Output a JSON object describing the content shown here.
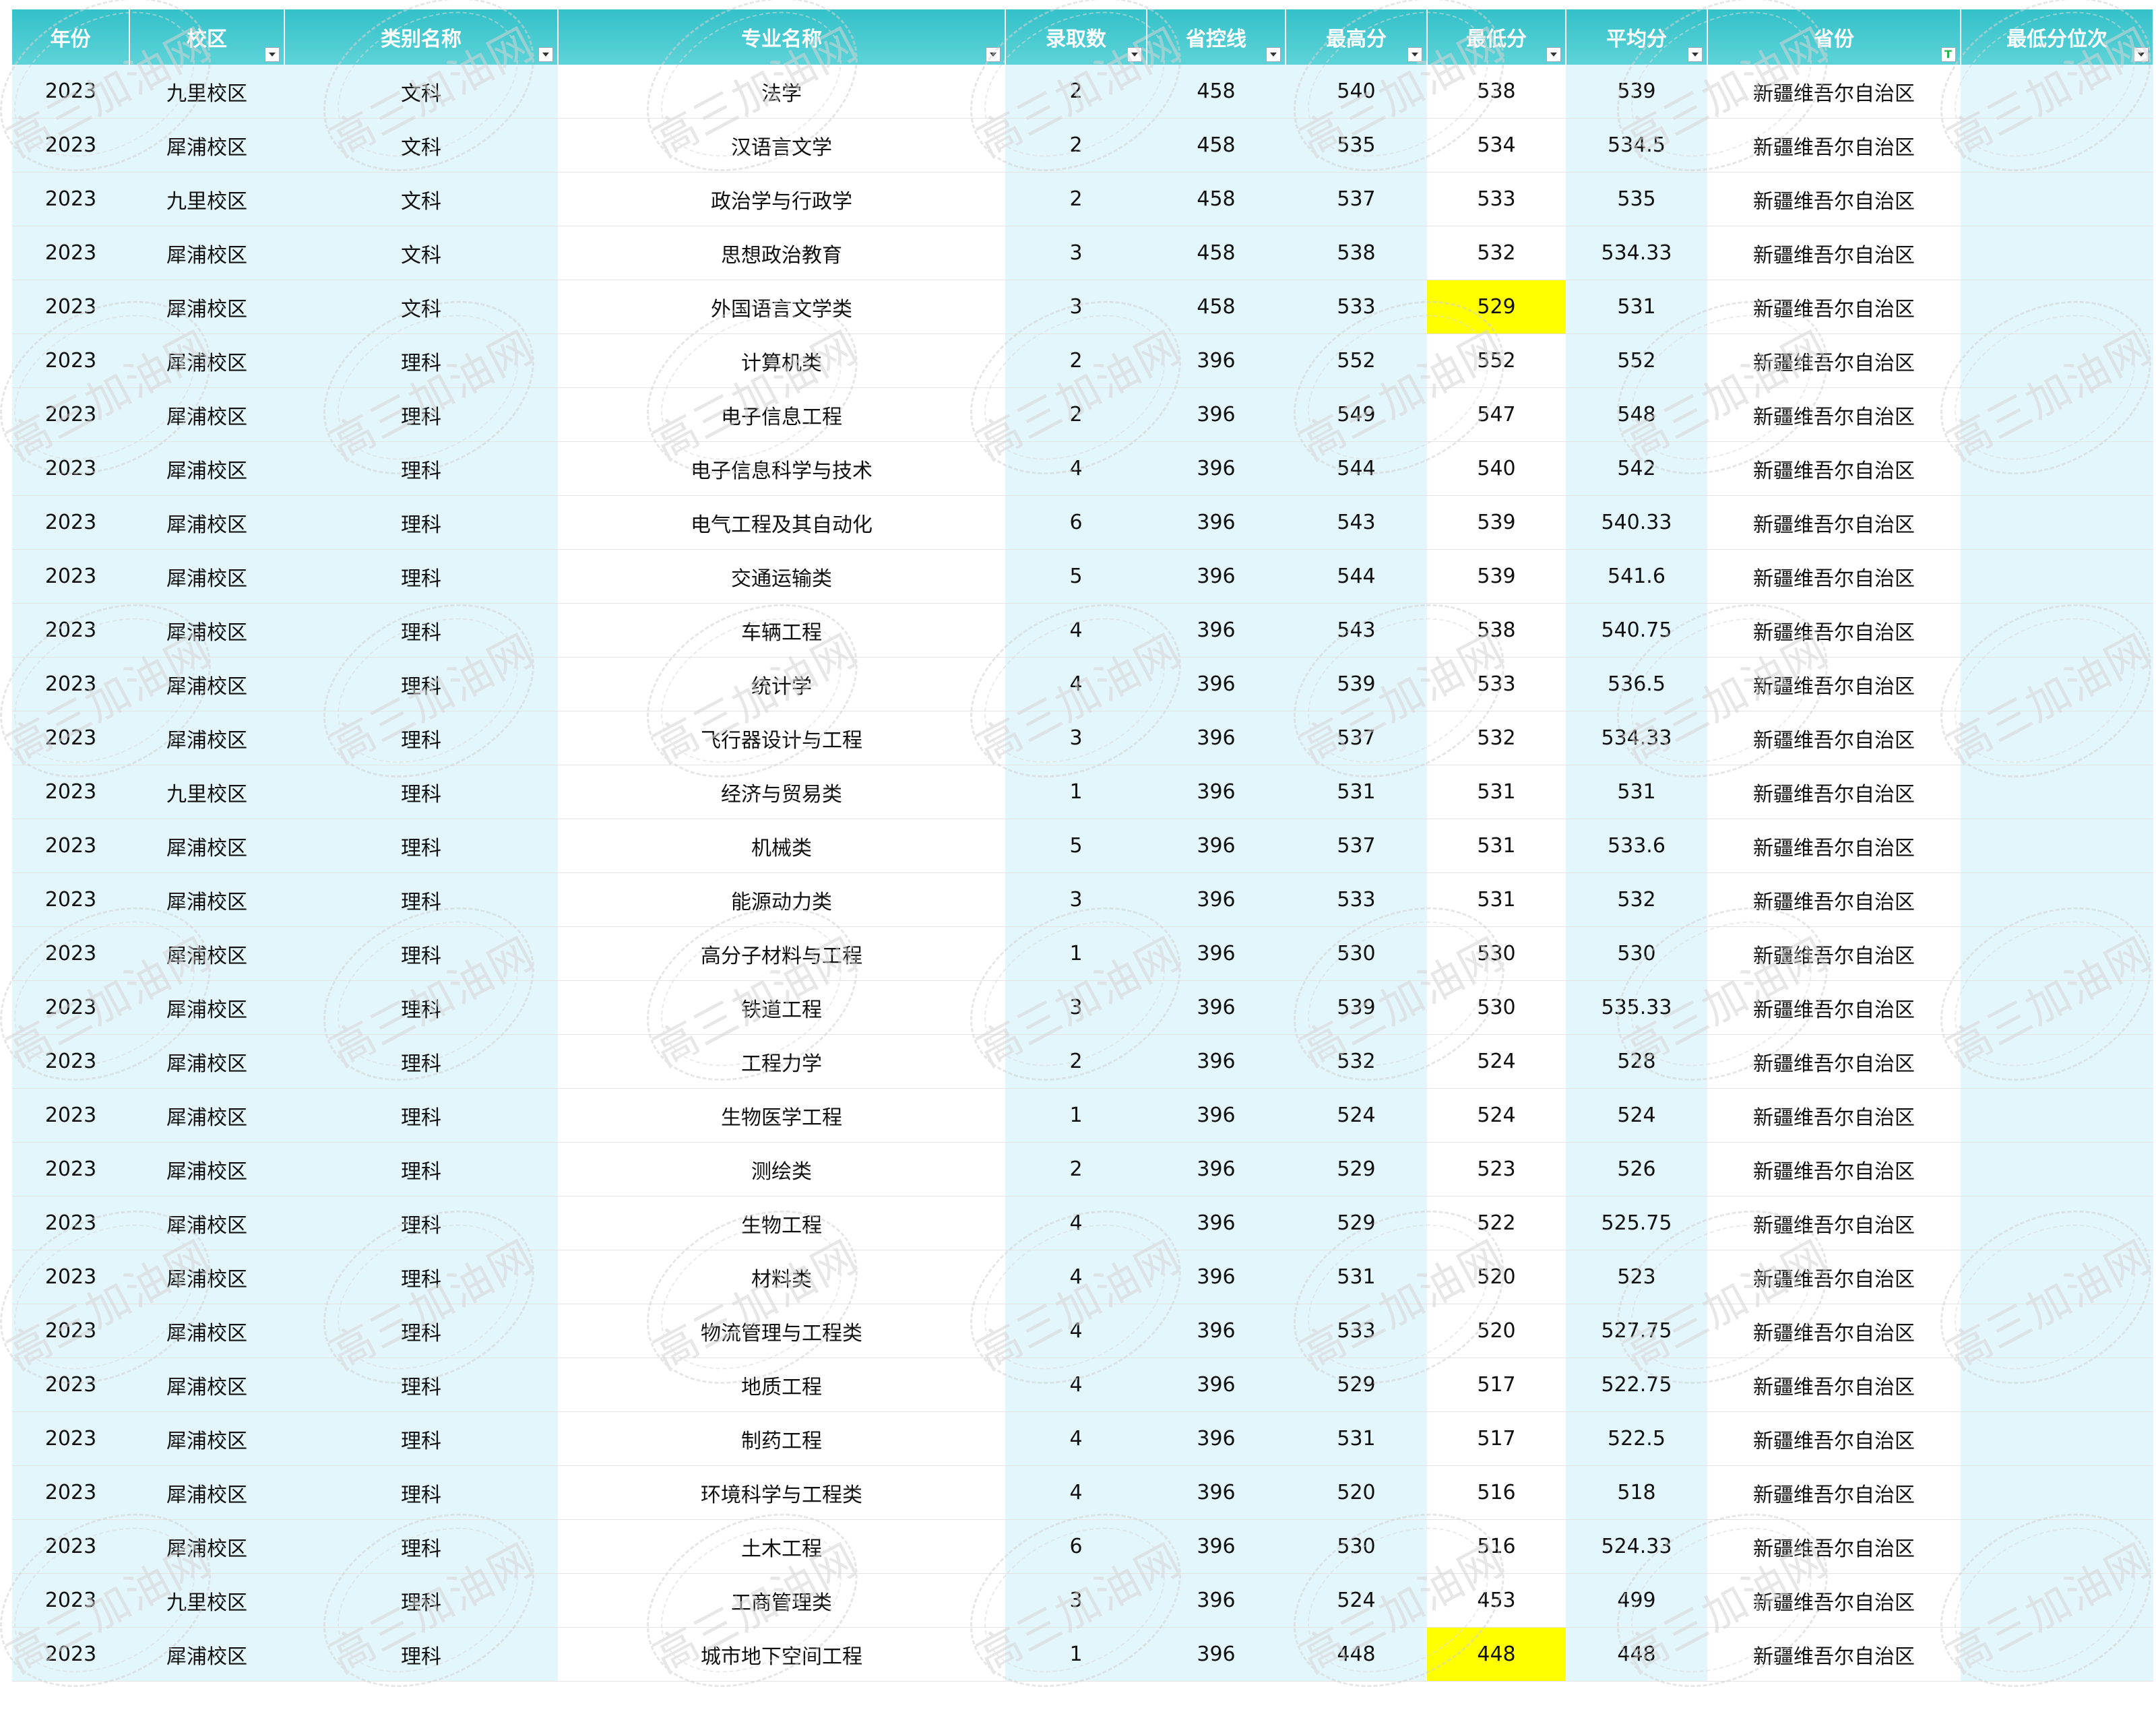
{
  "columns": [
    {
      "key": "year",
      "label": "年份"
    },
    {
      "key": "campus",
      "label": "校区"
    },
    {
      "key": "category",
      "label": "类别名称"
    },
    {
      "key": "major",
      "label": "专业名称"
    },
    {
      "key": "admitted",
      "label": "录取数"
    },
    {
      "key": "control_line",
      "label": "省控线"
    },
    {
      "key": "max",
      "label": "最高分"
    },
    {
      "key": "min",
      "label": "最低分"
    },
    {
      "key": "avg",
      "label": "平均分"
    },
    {
      "key": "province",
      "label": "省份"
    },
    {
      "key": "min_rank",
      "label": "最低分位次"
    }
  ],
  "highlight_color": "#ffff00",
  "header_color": "#33c1c8",
  "rows": [
    {
      "year": "2023",
      "campus": "九里校区",
      "category": "文科",
      "major": "法学",
      "admitted": "2",
      "control_line": "458",
      "max": "540",
      "min": "538",
      "avg": "539",
      "province": "新疆维吾尔自治区",
      "min_rank": "",
      "min_highlight": false
    },
    {
      "year": "2023",
      "campus": "犀浦校区",
      "category": "文科",
      "major": "汉语言文学",
      "admitted": "2",
      "control_line": "458",
      "max": "535",
      "min": "534",
      "avg": "534.5",
      "province": "新疆维吾尔自治区",
      "min_rank": "",
      "min_highlight": false
    },
    {
      "year": "2023",
      "campus": "九里校区",
      "category": "文科",
      "major": "政治学与行政学",
      "admitted": "2",
      "control_line": "458",
      "max": "537",
      "min": "533",
      "avg": "535",
      "province": "新疆维吾尔自治区",
      "min_rank": "",
      "min_highlight": false
    },
    {
      "year": "2023",
      "campus": "犀浦校区",
      "category": "文科",
      "major": "思想政治教育",
      "admitted": "3",
      "control_line": "458",
      "max": "538",
      "min": "532",
      "avg": "534.33",
      "province": "新疆维吾尔自治区",
      "min_rank": "",
      "min_highlight": false
    },
    {
      "year": "2023",
      "campus": "犀浦校区",
      "category": "文科",
      "major": "外国语言文学类",
      "admitted": "3",
      "control_line": "458",
      "max": "533",
      "min": "529",
      "avg": "531",
      "province": "新疆维吾尔自治区",
      "min_rank": "",
      "min_highlight": true
    },
    {
      "year": "2023",
      "campus": "犀浦校区",
      "category": "理科",
      "major": "计算机类",
      "admitted": "2",
      "control_line": "396",
      "max": "552",
      "min": "552",
      "avg": "552",
      "province": "新疆维吾尔自治区",
      "min_rank": "",
      "min_highlight": false
    },
    {
      "year": "2023",
      "campus": "犀浦校区",
      "category": "理科",
      "major": "电子信息工程",
      "admitted": "2",
      "control_line": "396",
      "max": "549",
      "min": "547",
      "avg": "548",
      "province": "新疆维吾尔自治区",
      "min_rank": "",
      "min_highlight": false
    },
    {
      "year": "2023",
      "campus": "犀浦校区",
      "category": "理科",
      "major": "电子信息科学与技术",
      "admitted": "4",
      "control_line": "396",
      "max": "544",
      "min": "540",
      "avg": "542",
      "province": "新疆维吾尔自治区",
      "min_rank": "",
      "min_highlight": false
    },
    {
      "year": "2023",
      "campus": "犀浦校区",
      "category": "理科",
      "major": "电气工程及其自动化",
      "admitted": "6",
      "control_line": "396",
      "max": "543",
      "min": "539",
      "avg": "540.33",
      "province": "新疆维吾尔自治区",
      "min_rank": "",
      "min_highlight": false
    },
    {
      "year": "2023",
      "campus": "犀浦校区",
      "category": "理科",
      "major": "交通运输类",
      "admitted": "5",
      "control_line": "396",
      "max": "544",
      "min": "539",
      "avg": "541.6",
      "province": "新疆维吾尔自治区",
      "min_rank": "",
      "min_highlight": false
    },
    {
      "year": "2023",
      "campus": "犀浦校区",
      "category": "理科",
      "major": "车辆工程",
      "admitted": "4",
      "control_line": "396",
      "max": "543",
      "min": "538",
      "avg": "540.75",
      "province": "新疆维吾尔自治区",
      "min_rank": "",
      "min_highlight": false
    },
    {
      "year": "2023",
      "campus": "犀浦校区",
      "category": "理科",
      "major": "统计学",
      "admitted": "4",
      "control_line": "396",
      "max": "539",
      "min": "533",
      "avg": "536.5",
      "province": "新疆维吾尔自治区",
      "min_rank": "",
      "min_highlight": false
    },
    {
      "year": "2023",
      "campus": "犀浦校区",
      "category": "理科",
      "major": "飞行器设计与工程",
      "admitted": "3",
      "control_line": "396",
      "max": "537",
      "min": "532",
      "avg": "534.33",
      "province": "新疆维吾尔自治区",
      "min_rank": "",
      "min_highlight": false
    },
    {
      "year": "2023",
      "campus": "九里校区",
      "category": "理科",
      "major": "经济与贸易类",
      "admitted": "1",
      "control_line": "396",
      "max": "531",
      "min": "531",
      "avg": "531",
      "province": "新疆维吾尔自治区",
      "min_rank": "",
      "min_highlight": false
    },
    {
      "year": "2023",
      "campus": "犀浦校区",
      "category": "理科",
      "major": "机械类",
      "admitted": "5",
      "control_line": "396",
      "max": "537",
      "min": "531",
      "avg": "533.6",
      "province": "新疆维吾尔自治区",
      "min_rank": "",
      "min_highlight": false
    },
    {
      "year": "2023",
      "campus": "犀浦校区",
      "category": "理科",
      "major": "能源动力类",
      "admitted": "3",
      "control_line": "396",
      "max": "533",
      "min": "531",
      "avg": "532",
      "province": "新疆维吾尔自治区",
      "min_rank": "",
      "min_highlight": false
    },
    {
      "year": "2023",
      "campus": "犀浦校区",
      "category": "理科",
      "major": "高分子材料与工程",
      "admitted": "1",
      "control_line": "396",
      "max": "530",
      "min": "530",
      "avg": "530",
      "province": "新疆维吾尔自治区",
      "min_rank": "",
      "min_highlight": false
    },
    {
      "year": "2023",
      "campus": "犀浦校区",
      "category": "理科",
      "major": "铁道工程",
      "admitted": "3",
      "control_line": "396",
      "max": "539",
      "min": "530",
      "avg": "535.33",
      "province": "新疆维吾尔自治区",
      "min_rank": "",
      "min_highlight": false
    },
    {
      "year": "2023",
      "campus": "犀浦校区",
      "category": "理科",
      "major": "工程力学",
      "admitted": "2",
      "control_line": "396",
      "max": "532",
      "min": "524",
      "avg": "528",
      "province": "新疆维吾尔自治区",
      "min_rank": "",
      "min_highlight": false
    },
    {
      "year": "2023",
      "campus": "犀浦校区",
      "category": "理科",
      "major": "生物医学工程",
      "admitted": "1",
      "control_line": "396",
      "max": "524",
      "min": "524",
      "avg": "524",
      "province": "新疆维吾尔自治区",
      "min_rank": "",
      "min_highlight": false
    },
    {
      "year": "2023",
      "campus": "犀浦校区",
      "category": "理科",
      "major": "测绘类",
      "admitted": "2",
      "control_line": "396",
      "max": "529",
      "min": "523",
      "avg": "526",
      "province": "新疆维吾尔自治区",
      "min_rank": "",
      "min_highlight": false
    },
    {
      "year": "2023",
      "campus": "犀浦校区",
      "category": "理科",
      "major": "生物工程",
      "admitted": "4",
      "control_line": "396",
      "max": "529",
      "min": "522",
      "avg": "525.75",
      "province": "新疆维吾尔自治区",
      "min_rank": "",
      "min_highlight": false
    },
    {
      "year": "2023",
      "campus": "犀浦校区",
      "category": "理科",
      "major": "材料类",
      "admitted": "4",
      "control_line": "396",
      "max": "531",
      "min": "520",
      "avg": "523",
      "province": "新疆维吾尔自治区",
      "min_rank": "",
      "min_highlight": false
    },
    {
      "year": "2023",
      "campus": "犀浦校区",
      "category": "理科",
      "major": "物流管理与工程类",
      "admitted": "4",
      "control_line": "396",
      "max": "533",
      "min": "520",
      "avg": "527.75",
      "province": "新疆维吾尔自治区",
      "min_rank": "",
      "min_highlight": false
    },
    {
      "year": "2023",
      "campus": "犀浦校区",
      "category": "理科",
      "major": "地质工程",
      "admitted": "4",
      "control_line": "396",
      "max": "529",
      "min": "517",
      "avg": "522.75",
      "province": "新疆维吾尔自治区",
      "min_rank": "",
      "min_highlight": false
    },
    {
      "year": "2023",
      "campus": "犀浦校区",
      "category": "理科",
      "major": "制药工程",
      "admitted": "4",
      "control_line": "396",
      "max": "531",
      "min": "517",
      "avg": "522.5",
      "province": "新疆维吾尔自治区",
      "min_rank": "",
      "min_highlight": false
    },
    {
      "year": "2023",
      "campus": "犀浦校区",
      "category": "理科",
      "major": "环境科学与工程类",
      "admitted": "4",
      "control_line": "396",
      "max": "520",
      "min": "516",
      "avg": "518",
      "province": "新疆维吾尔自治区",
      "min_rank": "",
      "min_highlight": false
    },
    {
      "year": "2023",
      "campus": "犀浦校区",
      "category": "理科",
      "major": "土木工程",
      "admitted": "6",
      "control_line": "396",
      "max": "530",
      "min": "516",
      "avg": "524.33",
      "province": "新疆维吾尔自治区",
      "min_rank": "",
      "min_highlight": false
    },
    {
      "year": "2023",
      "campus": "九里校区",
      "category": "理科",
      "major": "工商管理类",
      "admitted": "3",
      "control_line": "396",
      "max": "524",
      "min": "453",
      "avg": "499",
      "province": "新疆维吾尔自治区",
      "min_rank": "",
      "min_highlight": false
    },
    {
      "year": "2023",
      "campus": "犀浦校区",
      "category": "理科",
      "major": "城市地下空间工程",
      "admitted": "1",
      "control_line": "396",
      "max": "448",
      "min": "448",
      "avg": "448",
      "province": "新疆维吾尔自治区",
      "min_rank": "",
      "min_highlight": true
    }
  ],
  "watermark": {
    "text": "高三加油网"
  }
}
